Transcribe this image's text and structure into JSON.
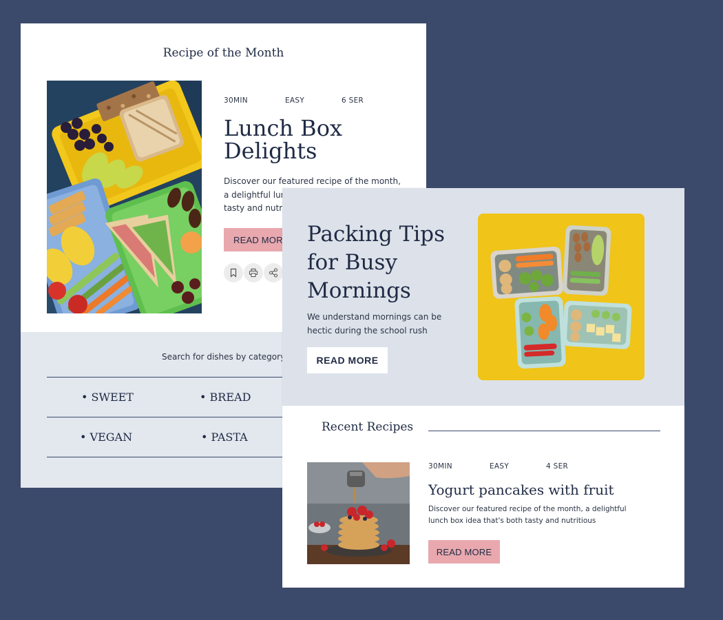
{
  "recipe_of_month": {
    "title": "Recipe of the Month",
    "meta": {
      "time": "30MIN",
      "difficulty": "EASY",
      "servings": "6 SER"
    },
    "recipe_title_line1": "Lunch Box",
    "recipe_title_line2": "Delights",
    "description_line1": "Discover our featured recipe of the month,",
    "description_line2": "a delightful lunch box idea that's both",
    "description_line3": "tasty and nutritious",
    "read_more": "READ MORE",
    "icons": [
      "bookmark-icon",
      "print-icon",
      "share-icon"
    ]
  },
  "categories": {
    "prompt": "Search for dishes by category",
    "items": [
      "SWEET",
      "BREAD",
      "VEGAN",
      "PASTA"
    ]
  },
  "packing_tips": {
    "title_line1": "Packing Tips",
    "title_line2": "for Busy",
    "title_line3": "Mornings",
    "description_line1": "We understand mornings can be",
    "description_line2": "hectic during the school rush",
    "read_more": "READ MORE"
  },
  "recent_recipes": {
    "heading": "Recent Recipes",
    "items": [
      {
        "meta": {
          "time": "30MIN",
          "difficulty": "EASY",
          "servings": "4 SER"
        },
        "title": "Yogurt pancakes with fruit",
        "description_line1": "Discover our featured recipe of the month, a delightful",
        "description_line2": "lunch box idea that's both tasty and nutritious",
        "read_more": "READ MORE"
      }
    ]
  },
  "colors": {
    "background": "#3b4a6b",
    "text": "#1f2a44",
    "accent_pink": "#e8a8ae",
    "panel_grey": "#e3e7ee",
    "hero_grey": "#dde2ea",
    "yellow": "#f0c418"
  }
}
